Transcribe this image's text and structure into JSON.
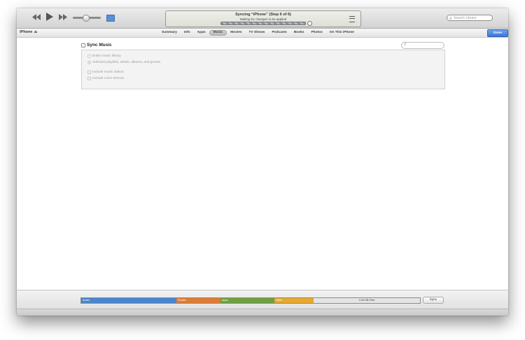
{
  "toolbar": {
    "icons": {
      "rewind": "rewind-icon",
      "play": "play-icon",
      "fast_forward": "fast-forward-icon",
      "airplay": "airplay-icon",
      "list": "list-icon",
      "search": "search-icon"
    },
    "volume": 0.5,
    "lcd": {
      "title": "Syncing “iPhone” (Step 6 of 6)",
      "subtitle": "Waiting for changes to be applied"
    },
    "search_placeholder": "Search Library"
  },
  "tabbar": {
    "device_name": "iPhone",
    "eject_glyph": "⏏",
    "tabs": [
      "Summary",
      "Info",
      "Apps",
      "Music",
      "Movies",
      "TV Shows",
      "Podcasts",
      "Books",
      "Photos",
      "On This iPhone"
    ],
    "active_tab": "Music",
    "done_label": "Done"
  },
  "music": {
    "sync_label": "Sync Music",
    "sync_checked": false,
    "options": {
      "entire_library": "Entire music library",
      "selected": "Selected playlists, artists, albums, and genres",
      "music_videos": "Include music videos",
      "voice_memos": "Include voice memos"
    },
    "search_placeholder": ""
  },
  "capacity": {
    "segments": [
      {
        "label": "Audio",
        "color": "#4a86cf",
        "fraction": 0.28
      },
      {
        "label": "Photos",
        "color": "#e07b33",
        "fraction": 0.13
      },
      {
        "label": "Apps",
        "color": "#6ea03f",
        "fraction": 0.16
      },
      {
        "label": "Other",
        "color": "#e8a82d",
        "fraction": 0.115
      }
    ],
    "free_label": "4.34 GB Free",
    "free_color": "#e4e4e4"
  },
  "sync_button": "Sync"
}
